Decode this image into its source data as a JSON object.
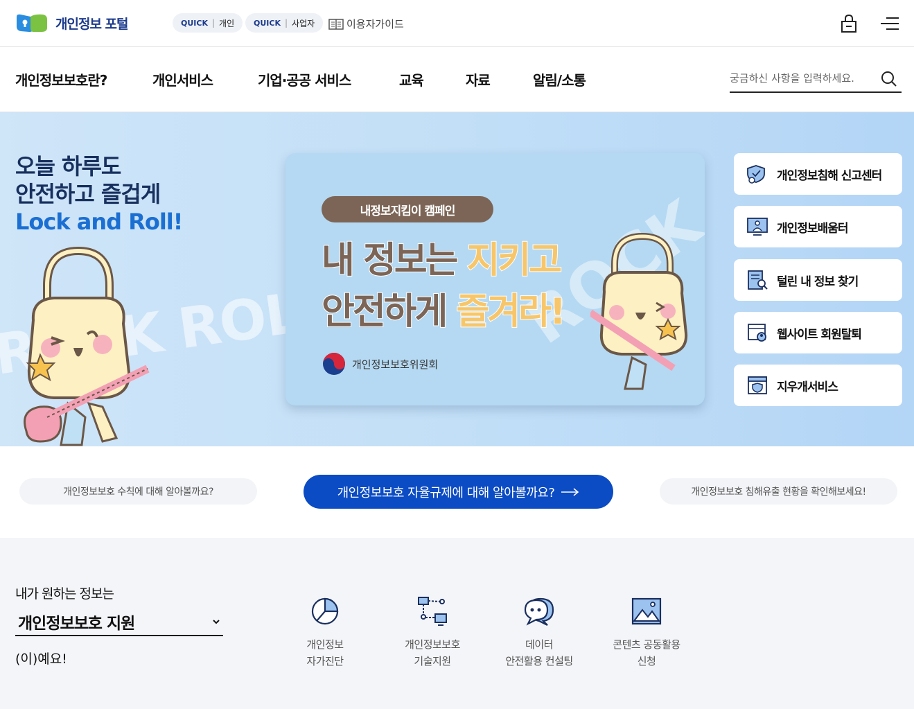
{
  "header": {
    "logo_text": "개인정보 포털",
    "quick_personal": {
      "tag": "QUICK",
      "label": "개인"
    },
    "quick_business": {
      "tag": "QUICK",
      "label": "사업자"
    },
    "guide_label": "이용자가이드"
  },
  "nav": {
    "items": [
      "개인정보보호란?",
      "개인서비스",
      "기업·공공 서비스",
      "교육",
      "자료",
      "알림/소통"
    ],
    "search_placeholder": "궁금하신 사항을 입력하세요."
  },
  "hero": {
    "title_line1": "오늘 하루도",
    "title_line2": "안전하고 즐겁게",
    "title_line3": "Lock and Roll!",
    "banner": {
      "pill": "내정보지킴이 캠페인",
      "line1_a": "내 정보는 ",
      "line1_b": "지키고",
      "line2_a": "안전하게 ",
      "line2_b": "즐겨라!",
      "org": "개인정보보호위원회"
    },
    "side_buttons": [
      "개인정보침해 신고센터",
      "개인정보배움터",
      "털린 내 정보 찾기",
      "웹사이트 회원탈퇴",
      "지우개서비스"
    ]
  },
  "links": {
    "left": "개인정보보호 수칙에 대해 알아볼까요?",
    "center": "개인정보보호 자율규제에 대해 알아볼까요?",
    "right": "개인정보보호 침해유출 현황을 확인해보세요!"
  },
  "selector": {
    "prefix": "내가 원하는 정보는",
    "selected": "개인정보보호 지원",
    "suffix": "(이)예요!"
  },
  "services": [
    {
      "line1": "개인정보",
      "line2": "자가진단",
      "icon": "pie-chart-icon"
    },
    {
      "line1": "개인정보보호",
      "line2": "기술지원",
      "icon": "network-icon"
    },
    {
      "line1": "데이터",
      "line2": "안전활용 컨설팅",
      "icon": "chat-bubble-icon"
    },
    {
      "line1": "콘텐츠 공동활용",
      "line2": "신청",
      "icon": "image-icon"
    }
  ],
  "colors": {
    "brand": "#1b3a8c",
    "accent": "#0b4bc4",
    "hero_bg": "#c2dff7",
    "banner_text": "#7c6556"
  }
}
